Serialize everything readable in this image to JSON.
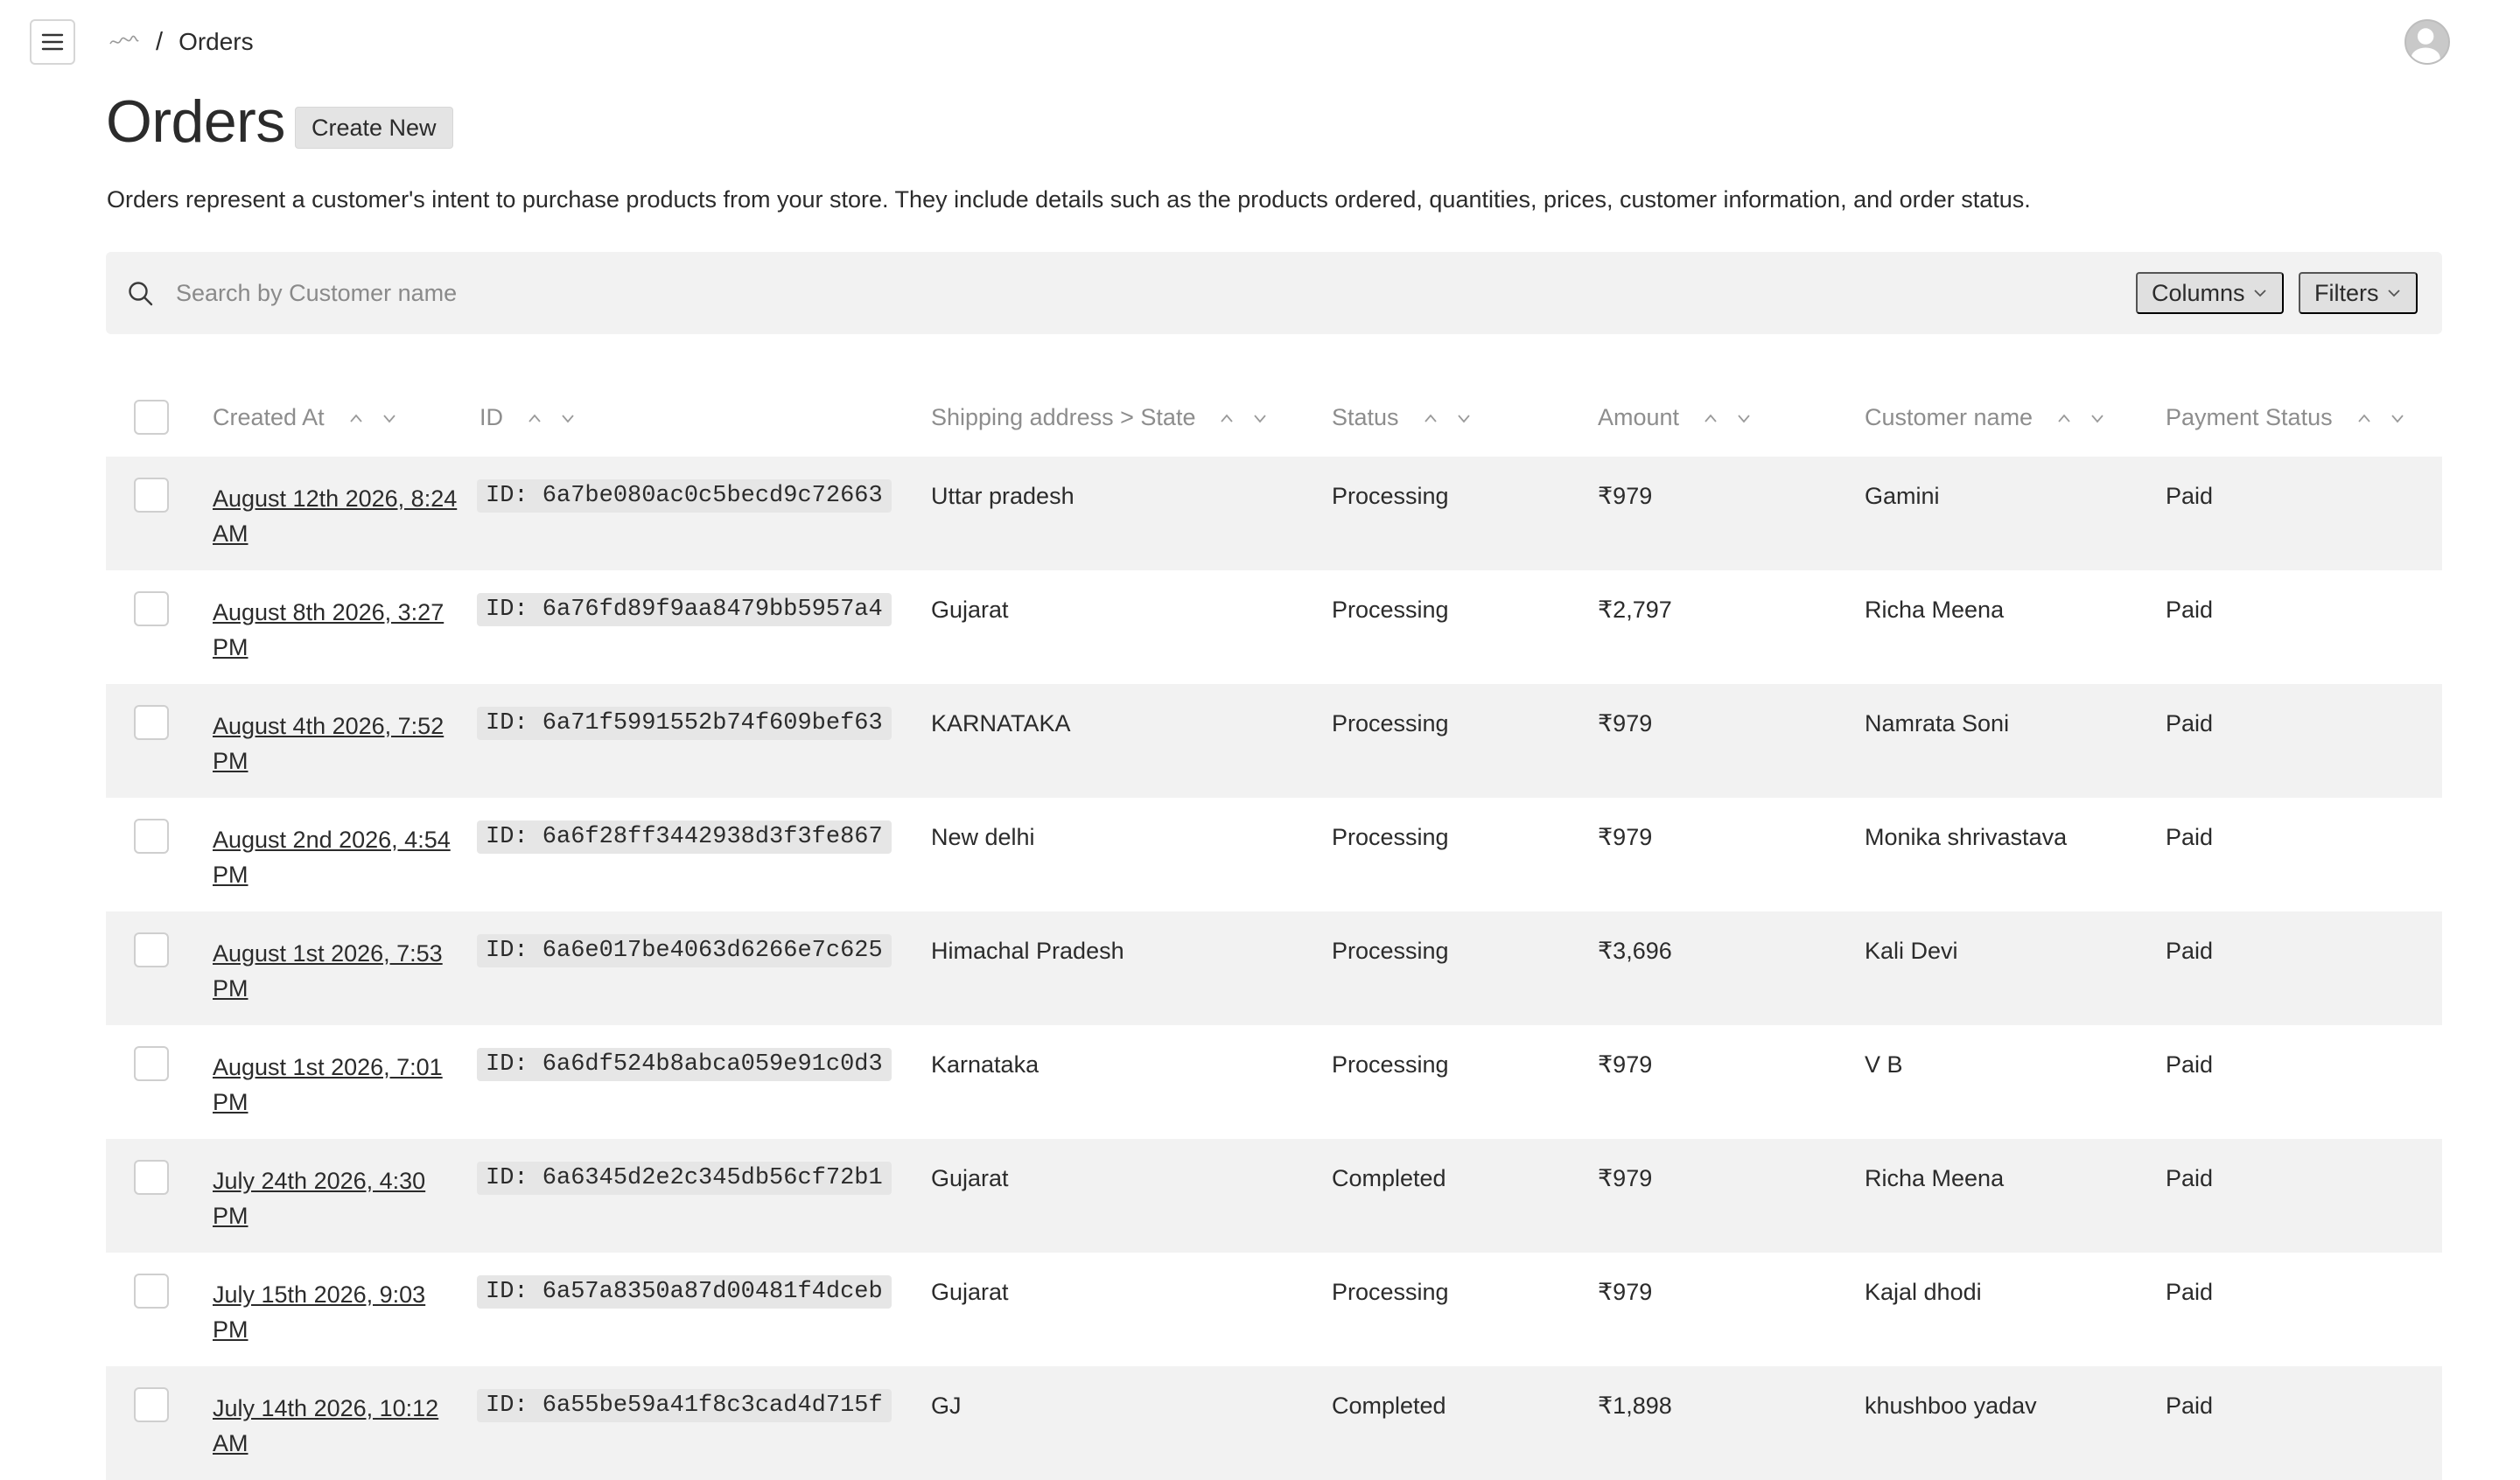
{
  "breadcrumb": {
    "separator": "/",
    "current": "Orders"
  },
  "page": {
    "title": "Orders",
    "create_label": "Create New",
    "description": "Orders represent a customer's intent to purchase products from your store. They include details such as the products ordered, quantities, prices, customer information, and order status."
  },
  "search": {
    "placeholder": "Search by Customer name",
    "value": ""
  },
  "toolbar": {
    "columns_label": "Columns",
    "filters_label": "Filters"
  },
  "table": {
    "headers": {
      "created_at": "Created At",
      "id": "ID",
      "state": "Shipping address > State",
      "status": "Status",
      "amount": "Amount",
      "customer": "Customer name",
      "payment": "Payment Status"
    },
    "rows": [
      {
        "created_at": "August 12th 2026, 8:24 AM",
        "id": "ID: 6a7be080ac0c5becd9c72663",
        "state": "Uttar pradesh",
        "status": "Processing",
        "amount": "₹979",
        "customer": "Gamini",
        "payment": "Paid"
      },
      {
        "created_at": "August 8th 2026, 3:27 PM",
        "id": "ID: 6a76fd89f9aa8479bb5957a4",
        "state": "Gujarat",
        "status": "Processing",
        "amount": "₹2,797",
        "customer": "Richa Meena",
        "payment": "Paid"
      },
      {
        "created_at": "August 4th 2026, 7:52 PM",
        "id": "ID: 6a71f5991552b74f609bef63",
        "state": "KARNATAKA",
        "status": "Processing",
        "amount": "₹979",
        "customer": "Namrata Soni",
        "payment": "Paid"
      },
      {
        "created_at": "August 2nd 2026, 4:54 PM",
        "id": "ID: 6a6f28ff3442938d3f3fe867",
        "state": "New delhi",
        "status": "Processing",
        "amount": "₹979",
        "customer": "Monika shrivastava",
        "payment": "Paid"
      },
      {
        "created_at": "August 1st 2026, 7:53 PM",
        "id": "ID: 6a6e017be4063d6266e7c625",
        "state": "Himachal Pradesh",
        "status": "Processing",
        "amount": "₹3,696",
        "customer": "Kali Devi",
        "payment": "Paid"
      },
      {
        "created_at": "August 1st 2026, 7:01 PM",
        "id": "ID: 6a6df524b8abca059e91c0d3",
        "state": "Karnataka",
        "status": "Processing",
        "amount": "₹979",
        "customer": "V B",
        "payment": "Paid"
      },
      {
        "created_at": "July 24th 2026, 4:30 PM",
        "id": "ID: 6a6345d2e2c345db56cf72b1",
        "state": "Gujarat",
        "status": "Completed",
        "amount": "₹979",
        "customer": "Richa Meena",
        "payment": "Paid"
      },
      {
        "created_at": "July 15th 2026, 9:03 PM",
        "id": "ID: 6a57a8350a87d00481f4dceb",
        "state": "Gujarat",
        "status": "Processing",
        "amount": "₹979",
        "customer": "Kajal dhodi",
        "payment": "Paid"
      },
      {
        "created_at": "July 14th 2026, 10:12 AM",
        "id": "ID: 6a55be59a41f8c3cad4d715f",
        "state": "GJ",
        "status": "Completed",
        "amount": "₹1,898",
        "customer": "khushboo yadav",
        "payment": "Paid"
      }
    ]
  }
}
